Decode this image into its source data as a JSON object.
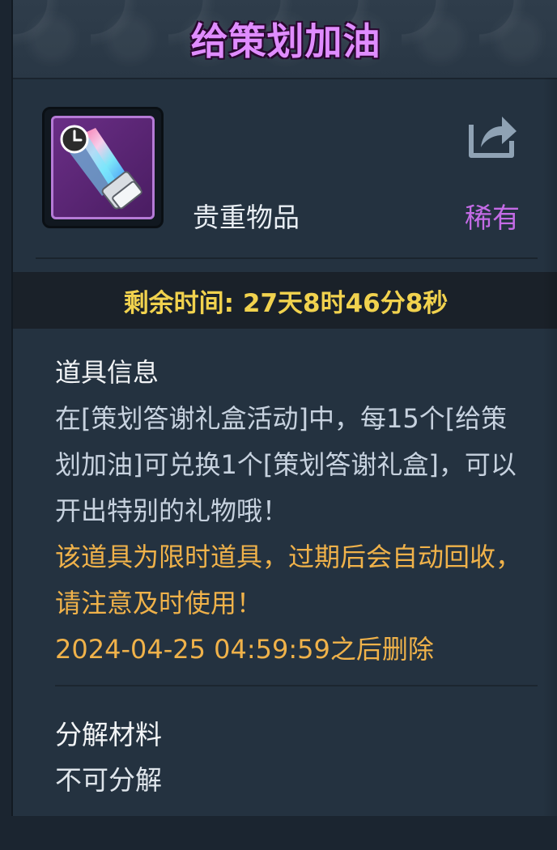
{
  "title": "给策划加油",
  "item": {
    "icon": "purple-crystal-sword-icon",
    "badge_icon": "clock-icon",
    "category": "贵重物品",
    "rarity": "稀有",
    "share_icon": "share-icon"
  },
  "timer": {
    "text": "剩余时间: 27天8时46分8秒"
  },
  "info": {
    "heading": "道具信息",
    "description": "在[策划答谢礼盒活动]中，每15个[给策划加油]可兑换1个[策划答谢礼盒]，可以开出特别的礼物哦！",
    "warning": "该道具为限时道具，过期后会自动回收，请注意及时使用！",
    "expiry": "2024-04-25 04:59:59之后删除"
  },
  "decompose": {
    "heading": "分解材料",
    "value": "不可分解"
  },
  "colors": {
    "title": "#e08cff",
    "rarity": "#c46be6",
    "timer": "#f1d24e",
    "warning": "#f0b24a"
  }
}
